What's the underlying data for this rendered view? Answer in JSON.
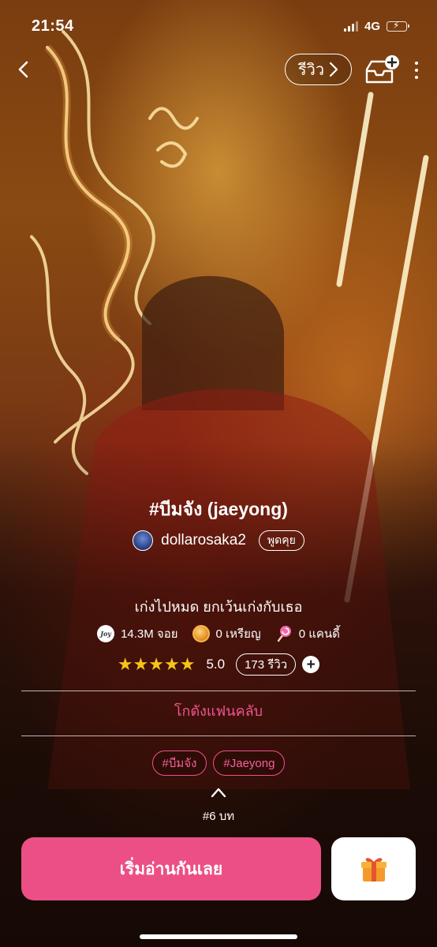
{
  "status_bar": {
    "time": "21:54",
    "network": "4G"
  },
  "header": {
    "review_label": "รีวิว"
  },
  "story": {
    "title": "#บีมจัง (jaeyong)",
    "author": "dollarosaka2",
    "chat_label": "พูดคุย",
    "tagline": "เก่งไปหมด ยกเว้นเก่งกับเธอ",
    "stats": {
      "joy_icon_text": "Joy",
      "joy": "14.3M จอย",
      "coins": "0 เหรียญ",
      "candy": "0 แคนดี้"
    },
    "rating": {
      "stars": "★★★★★",
      "value": "5.0",
      "review_count": "173 รีวิว"
    },
    "fanclub_label": "โกดังแฟนคลับ",
    "tags": [
      "#บีมจัง",
      "#Jaeyong"
    ],
    "chapters": "#6 บท"
  },
  "actions": {
    "start_label": "เริ่มอ่านกันเลย"
  },
  "colors": {
    "accent_pink": "#ec4f85",
    "tag_pink": "#f0508c",
    "star_yellow": "#f5c518",
    "battery_green": "#4cd964"
  },
  "icons": {
    "back": "chevron-left-icon",
    "shelf": "add-to-shelf-icon",
    "more": "more-vertical-icon",
    "gift": "gift-icon"
  }
}
